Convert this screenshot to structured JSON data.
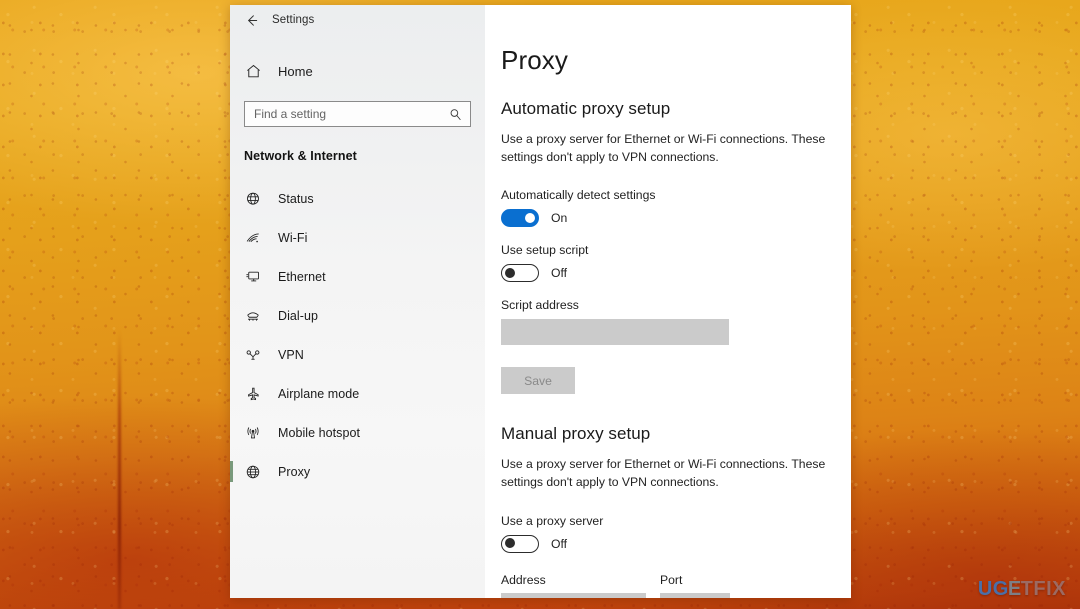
{
  "window": {
    "titlebar": {
      "back_icon": "back-arrow-icon",
      "app_title": "Settings"
    }
  },
  "sidebar": {
    "home": {
      "icon": "home-icon",
      "label": "Home"
    },
    "search": {
      "placeholder": "Find a setting",
      "value": "",
      "icon": "search-icon"
    },
    "category": "Network & Internet",
    "items": [
      {
        "icon": "globe-status-icon",
        "label": "Status",
        "selected": false
      },
      {
        "icon": "wifi-icon",
        "label": "Wi-Fi",
        "selected": false
      },
      {
        "icon": "ethernet-icon",
        "label": "Ethernet",
        "selected": false
      },
      {
        "icon": "dialup-icon",
        "label": "Dial-up",
        "selected": false
      },
      {
        "icon": "vpn-icon",
        "label": "VPN",
        "selected": false
      },
      {
        "icon": "airplane-icon",
        "label": "Airplane mode",
        "selected": false
      },
      {
        "icon": "hotspot-icon",
        "label": "Mobile hotspot",
        "selected": false
      },
      {
        "icon": "proxy-globe-icon",
        "label": "Proxy",
        "selected": true
      }
    ]
  },
  "main": {
    "page_title": "Proxy",
    "automatic": {
      "heading": "Automatic proxy setup",
      "description": "Use a proxy server for Ethernet or Wi-Fi connections. These settings don't apply to VPN connections.",
      "auto_detect": {
        "label": "Automatically detect settings",
        "state": "On",
        "on": true
      },
      "setup_script": {
        "label": "Use setup script",
        "state": "Off",
        "on": false
      },
      "script_address": {
        "label": "Script address",
        "value": ""
      },
      "save_label": "Save"
    },
    "manual": {
      "heading": "Manual proxy setup",
      "description": "Use a proxy server for Ethernet or Wi-Fi connections. These settings don't apply to VPN connections.",
      "use_proxy": {
        "label": "Use a proxy server",
        "state": "Off",
        "on": false
      },
      "address": {
        "label": "Address",
        "value": ""
      },
      "port": {
        "label": "Port",
        "value": ""
      }
    }
  },
  "watermark": {
    "part1": "UG",
    "part2": "E",
    "part3": "TFIX",
    "full": "UGETFIX"
  },
  "colors": {
    "accent_blue": "#0a6fd0",
    "selected_marker": "#7a9a7c",
    "disabled_field": "#cbcbcb",
    "background_amber": "#e8a61b",
    "background_deep": "#b03c09"
  }
}
